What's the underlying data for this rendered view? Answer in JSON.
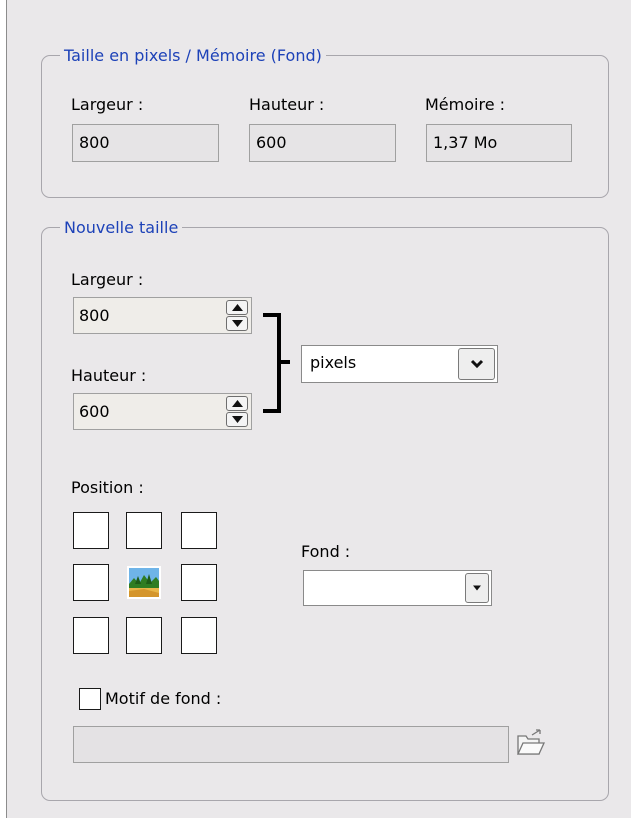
{
  "pixel_group": {
    "title": "Taille en pixels / Mémoire (Fond)",
    "width_label": "Largeur :",
    "width_value": "800",
    "height_label": "Hauteur :",
    "height_value": "600",
    "memory_label": "Mémoire :",
    "memory_value": "1,37 Mo"
  },
  "new_size_group": {
    "title": "Nouvelle taille",
    "width_label": "Largeur :",
    "width_value": "800",
    "height_label": "Hauteur :",
    "height_value": "600",
    "unit_value": "pixels",
    "position_label": "Position :",
    "position_selected": "center",
    "background_label": "Fond :",
    "background_value": "",
    "pattern_label": "Motif de fond :",
    "pattern_checked": false,
    "pattern_path": ""
  },
  "icons": {
    "spin_up": "arrow-up-icon",
    "spin_down": "arrow-down-icon",
    "dropdown": "chevron-down-icon",
    "anchor": "landscape-image-icon",
    "browse": "open-folder-icon"
  }
}
